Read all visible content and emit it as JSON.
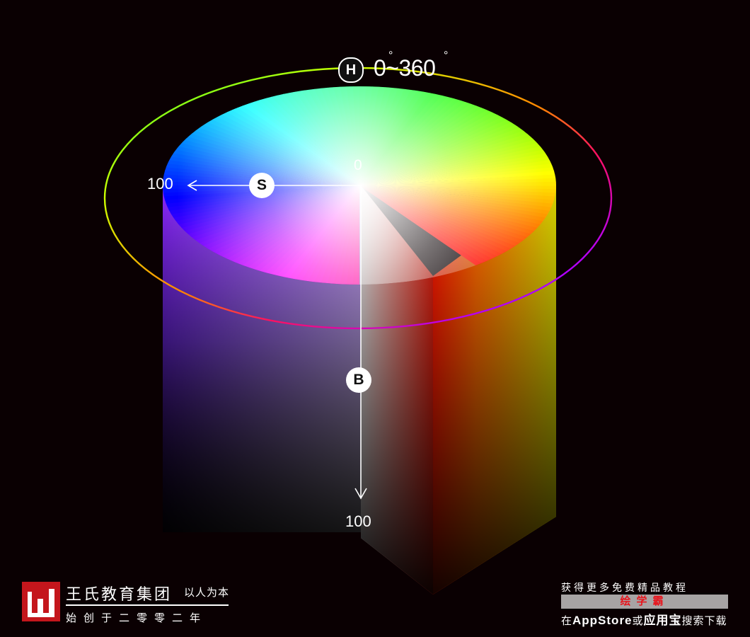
{
  "hue_label": "0~360",
  "degree_symbol": "°",
  "h_pin": "H",
  "s_pin": "S",
  "b_pin": "B",
  "s_axis_max": "100",
  "center_zero": "0",
  "b_axis_max": "100",
  "brand": {
    "name": "王氏教育集团",
    "motto": "以人为本",
    "since": "始创于二零零二年"
  },
  "promo": {
    "top": "获得更多免费精品教程",
    "app": "绘学霸",
    "bottom_prefix": "在",
    "bottom_store": "AppStore",
    "bottom_or": "或",
    "bottom_app": "应用宝",
    "bottom_suffix": "搜索下载"
  },
  "colors": {
    "background": "#0a0002",
    "brand_red": "#c4161c",
    "promo_bar": "#a7a4a4",
    "promo_text": "#e8141c"
  }
}
